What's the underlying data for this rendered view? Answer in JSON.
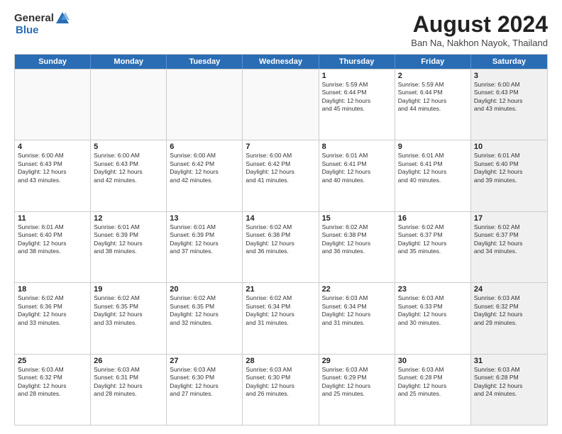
{
  "header": {
    "logo_general": "General",
    "logo_blue": "Blue",
    "month_title": "August 2024",
    "location": "Ban Na, Nakhon Nayok, Thailand"
  },
  "days_of_week": [
    "Sunday",
    "Monday",
    "Tuesday",
    "Wednesday",
    "Thursday",
    "Friday",
    "Saturday"
  ],
  "weeks": [
    [
      {
        "day": "",
        "info": [],
        "empty": true
      },
      {
        "day": "",
        "info": [],
        "empty": true
      },
      {
        "day": "",
        "info": [],
        "empty": true
      },
      {
        "day": "",
        "info": [],
        "empty": true
      },
      {
        "day": "1",
        "info": [
          "Sunrise: 5:59 AM",
          "Sunset: 6:44 PM",
          "Daylight: 12 hours",
          "and 45 minutes."
        ],
        "empty": false
      },
      {
        "day": "2",
        "info": [
          "Sunrise: 5:59 AM",
          "Sunset: 6:44 PM",
          "Daylight: 12 hours",
          "and 44 minutes."
        ],
        "empty": false
      },
      {
        "day": "3",
        "info": [
          "Sunrise: 6:00 AM",
          "Sunset: 6:43 PM",
          "Daylight: 12 hours",
          "and 43 minutes."
        ],
        "empty": false,
        "shaded": true
      }
    ],
    [
      {
        "day": "4",
        "info": [
          "Sunrise: 6:00 AM",
          "Sunset: 6:43 PM",
          "Daylight: 12 hours",
          "and 43 minutes."
        ],
        "empty": false
      },
      {
        "day": "5",
        "info": [
          "Sunrise: 6:00 AM",
          "Sunset: 6:43 PM",
          "Daylight: 12 hours",
          "and 42 minutes."
        ],
        "empty": false
      },
      {
        "day": "6",
        "info": [
          "Sunrise: 6:00 AM",
          "Sunset: 6:42 PM",
          "Daylight: 12 hours",
          "and 42 minutes."
        ],
        "empty": false
      },
      {
        "day": "7",
        "info": [
          "Sunrise: 6:00 AM",
          "Sunset: 6:42 PM",
          "Daylight: 12 hours",
          "and 41 minutes."
        ],
        "empty": false
      },
      {
        "day": "8",
        "info": [
          "Sunrise: 6:01 AM",
          "Sunset: 6:41 PM",
          "Daylight: 12 hours",
          "and 40 minutes."
        ],
        "empty": false
      },
      {
        "day": "9",
        "info": [
          "Sunrise: 6:01 AM",
          "Sunset: 6:41 PM",
          "Daylight: 12 hours",
          "and 40 minutes."
        ],
        "empty": false
      },
      {
        "day": "10",
        "info": [
          "Sunrise: 6:01 AM",
          "Sunset: 6:40 PM",
          "Daylight: 12 hours",
          "and 39 minutes."
        ],
        "empty": false,
        "shaded": true
      }
    ],
    [
      {
        "day": "11",
        "info": [
          "Sunrise: 6:01 AM",
          "Sunset: 6:40 PM",
          "Daylight: 12 hours",
          "and 38 minutes."
        ],
        "empty": false
      },
      {
        "day": "12",
        "info": [
          "Sunrise: 6:01 AM",
          "Sunset: 6:39 PM",
          "Daylight: 12 hours",
          "and 38 minutes."
        ],
        "empty": false
      },
      {
        "day": "13",
        "info": [
          "Sunrise: 6:01 AM",
          "Sunset: 6:39 PM",
          "Daylight: 12 hours",
          "and 37 minutes."
        ],
        "empty": false
      },
      {
        "day": "14",
        "info": [
          "Sunrise: 6:02 AM",
          "Sunset: 6:38 PM",
          "Daylight: 12 hours",
          "and 36 minutes."
        ],
        "empty": false
      },
      {
        "day": "15",
        "info": [
          "Sunrise: 6:02 AM",
          "Sunset: 6:38 PM",
          "Daylight: 12 hours",
          "and 36 minutes."
        ],
        "empty": false
      },
      {
        "day": "16",
        "info": [
          "Sunrise: 6:02 AM",
          "Sunset: 6:37 PM",
          "Daylight: 12 hours",
          "and 35 minutes."
        ],
        "empty": false
      },
      {
        "day": "17",
        "info": [
          "Sunrise: 6:02 AM",
          "Sunset: 6:37 PM",
          "Daylight: 12 hours",
          "and 34 minutes."
        ],
        "empty": false,
        "shaded": true
      }
    ],
    [
      {
        "day": "18",
        "info": [
          "Sunrise: 6:02 AM",
          "Sunset: 6:36 PM",
          "Daylight: 12 hours",
          "and 33 minutes."
        ],
        "empty": false
      },
      {
        "day": "19",
        "info": [
          "Sunrise: 6:02 AM",
          "Sunset: 6:35 PM",
          "Daylight: 12 hours",
          "and 33 minutes."
        ],
        "empty": false
      },
      {
        "day": "20",
        "info": [
          "Sunrise: 6:02 AM",
          "Sunset: 6:35 PM",
          "Daylight: 12 hours",
          "and 32 minutes."
        ],
        "empty": false
      },
      {
        "day": "21",
        "info": [
          "Sunrise: 6:02 AM",
          "Sunset: 6:34 PM",
          "Daylight: 12 hours",
          "and 31 minutes."
        ],
        "empty": false
      },
      {
        "day": "22",
        "info": [
          "Sunrise: 6:03 AM",
          "Sunset: 6:34 PM",
          "Daylight: 12 hours",
          "and 31 minutes."
        ],
        "empty": false
      },
      {
        "day": "23",
        "info": [
          "Sunrise: 6:03 AM",
          "Sunset: 6:33 PM",
          "Daylight: 12 hours",
          "and 30 minutes."
        ],
        "empty": false
      },
      {
        "day": "24",
        "info": [
          "Sunrise: 6:03 AM",
          "Sunset: 6:32 PM",
          "Daylight: 12 hours",
          "and 29 minutes."
        ],
        "empty": false,
        "shaded": true
      }
    ],
    [
      {
        "day": "25",
        "info": [
          "Sunrise: 6:03 AM",
          "Sunset: 6:32 PM",
          "Daylight: 12 hours",
          "and 28 minutes."
        ],
        "empty": false
      },
      {
        "day": "26",
        "info": [
          "Sunrise: 6:03 AM",
          "Sunset: 6:31 PM",
          "Daylight: 12 hours",
          "and 28 minutes."
        ],
        "empty": false
      },
      {
        "day": "27",
        "info": [
          "Sunrise: 6:03 AM",
          "Sunset: 6:30 PM",
          "Daylight: 12 hours",
          "and 27 minutes."
        ],
        "empty": false
      },
      {
        "day": "28",
        "info": [
          "Sunrise: 6:03 AM",
          "Sunset: 6:30 PM",
          "Daylight: 12 hours",
          "and 26 minutes."
        ],
        "empty": false
      },
      {
        "day": "29",
        "info": [
          "Sunrise: 6:03 AM",
          "Sunset: 6:29 PM",
          "Daylight: 12 hours",
          "and 25 minutes."
        ],
        "empty": false
      },
      {
        "day": "30",
        "info": [
          "Sunrise: 6:03 AM",
          "Sunset: 6:28 PM",
          "Daylight: 12 hours",
          "and 25 minutes."
        ],
        "empty": false
      },
      {
        "day": "31",
        "info": [
          "Sunrise: 6:03 AM",
          "Sunset: 6:28 PM",
          "Daylight: 12 hours",
          "and 24 minutes."
        ],
        "empty": false,
        "shaded": true
      }
    ]
  ]
}
